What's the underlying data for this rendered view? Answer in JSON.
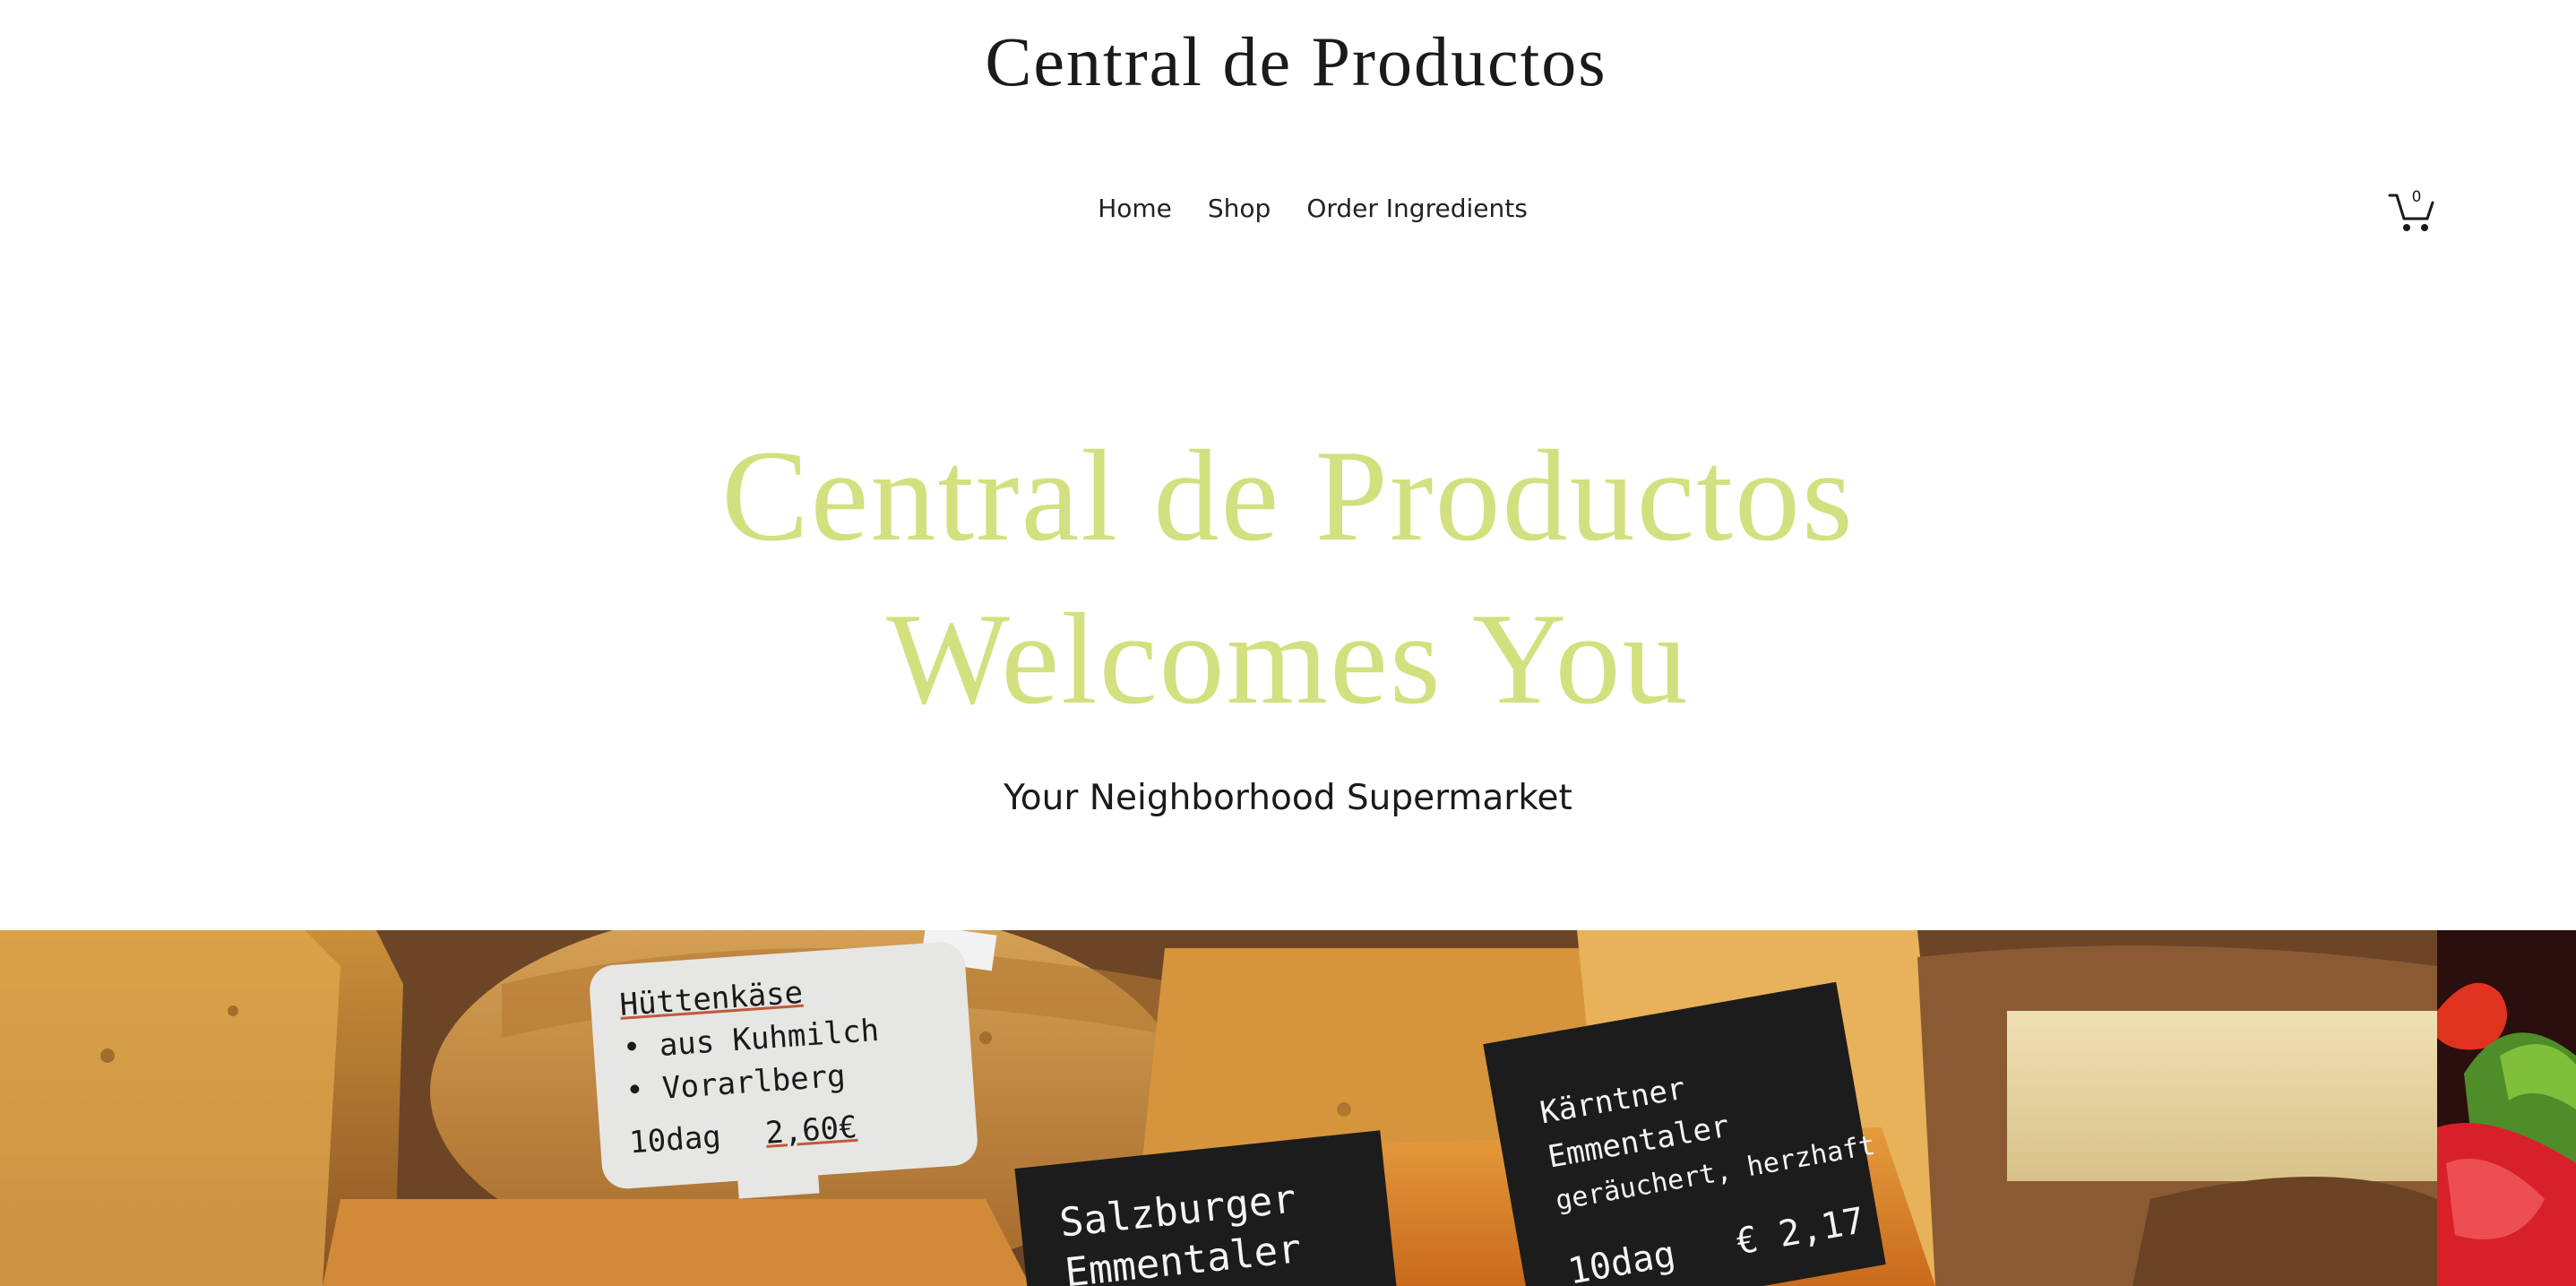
{
  "header": {
    "site_title": "Central de Productos"
  },
  "nav": {
    "items": [
      {
        "label": "Home"
      },
      {
        "label": "Shop"
      },
      {
        "label": "Order Ingredients"
      }
    ]
  },
  "cart": {
    "count": "0",
    "icon": "cart-icon"
  },
  "hero": {
    "heading_line1": "Central de Productos",
    "heading_line2": "Welcomes You",
    "subheading": "Your Neighborhood Supermarket"
  },
  "gallery": {
    "signs": {
      "sign1_line1": "Hüttenkäse",
      "sign1_line2": "• aus Kuhmilch",
      "sign1_line3": "• Vorarlberg",
      "sign1_weight": "10dag",
      "sign1_price": "2,60€",
      "sign2_line1": "Salzburger",
      "sign2_line2": "Emmentaler",
      "sign3_line1": "Kärntner Emmentaler",
      "sign3_line2": "geräuchert, herzhaft",
      "sign3_weight": "10dag",
      "sign3_price": "€ 2,17"
    }
  },
  "colors": {
    "hero_heading": "#d3e07f",
    "text": "#1a1a1a"
  }
}
